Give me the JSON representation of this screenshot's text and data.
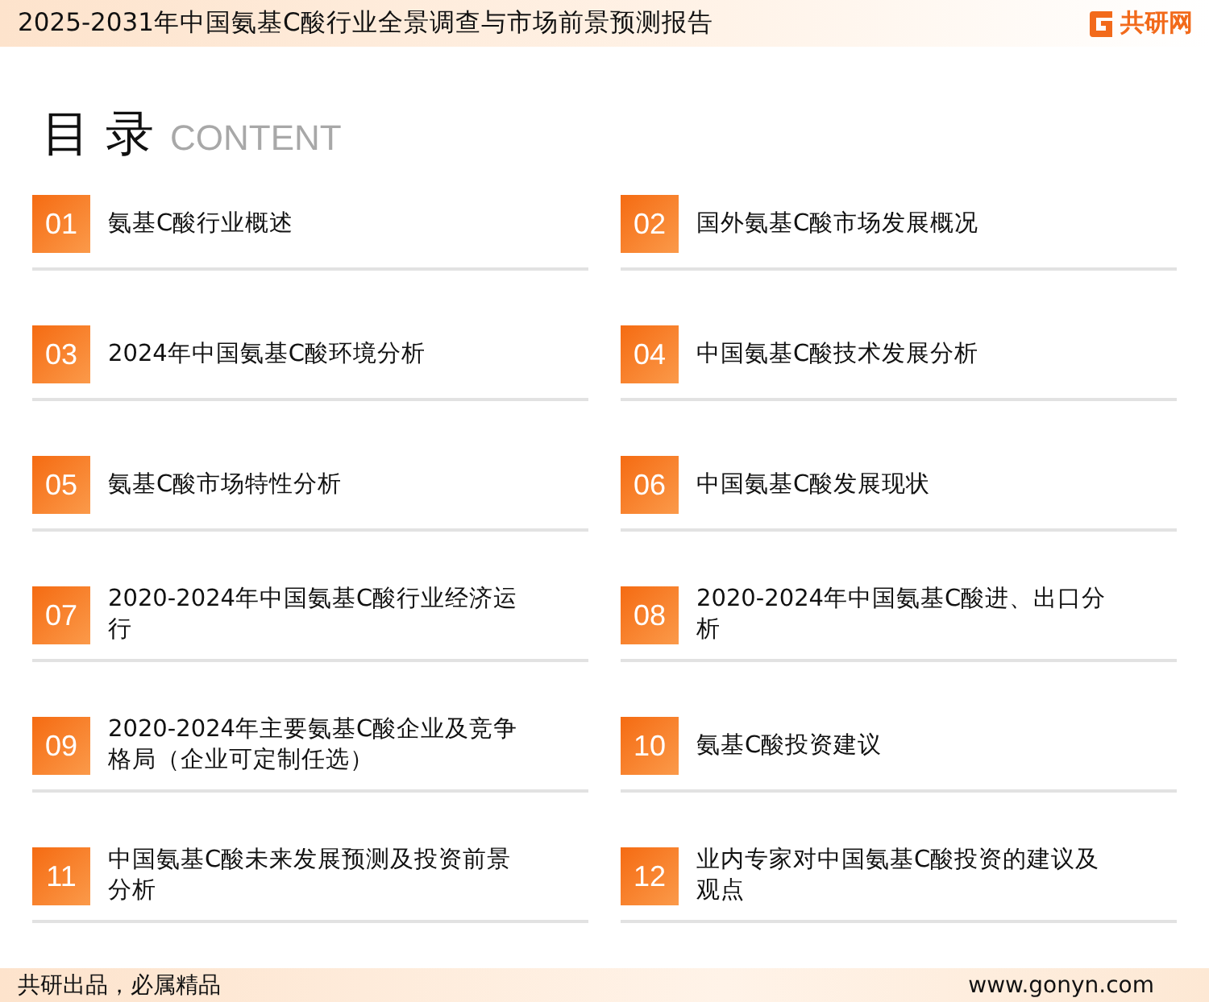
{
  "header": {
    "title": "2025-2031年中国氨基C酸行业全景调查与市场前景预测报告",
    "logo": "共研网"
  },
  "heading": {
    "title": "目 录",
    "subtitle": "CONTENT"
  },
  "toc": [
    {
      "number": "01",
      "title": "氨基C酸行业概述"
    },
    {
      "number": "02",
      "title": "国外氨基C酸市场发展概况"
    },
    {
      "number": "03",
      "title": "2024年中国氨基C酸环境分析"
    },
    {
      "number": "04",
      "title": "中国氨基C酸技术发展分析"
    },
    {
      "number": "05",
      "title": "氨基C酸市场特性分析"
    },
    {
      "number": "06",
      "title": "中国氨基C酸发展现状"
    },
    {
      "number": "07",
      "title": "2020-2024年中国氨基C酸行业经济运行"
    },
    {
      "number": "08",
      "title": "2020-2024年中国氨基C酸进、出口分析"
    },
    {
      "number": "09",
      "title": "2020-2024年主要氨基C酸企业及竞争格局（企业可定制任选）"
    },
    {
      "number": "10",
      "title": "氨基C酸投资建议"
    },
    {
      "number": "11",
      "title": "中国氨基C酸未来发展预测及投资前景分析"
    },
    {
      "number": "12",
      "title": "业内专家对中国氨基C酸投资的建议及观点"
    }
  ],
  "footer": {
    "slogan": "共研出品，必属精品",
    "url": "www.gonyn.com"
  }
}
